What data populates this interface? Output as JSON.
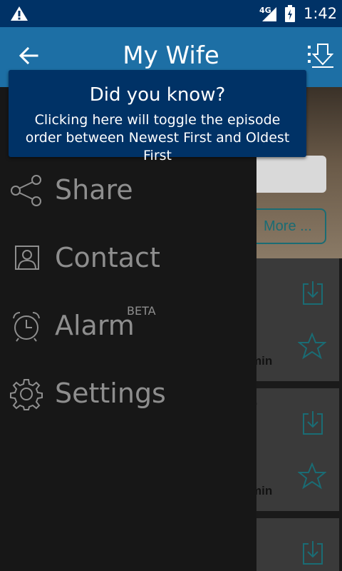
{
  "status_bar": {
    "network": "4G",
    "time": "1:42",
    "icons": [
      "warning-icon",
      "signal-icon",
      "battery-icon"
    ]
  },
  "app_bar": {
    "title": "My Wife",
    "icons": [
      "back-arrow-icon",
      "sort-order-icon"
    ]
  },
  "tooltip": {
    "title": "Did you know?",
    "body": "Clicking here will toggle the episode order between Newest First and Oldest First"
  },
  "drawer": {
    "items": [
      {
        "label": "Share",
        "icon": "share-icon"
      },
      {
        "label": "Contact",
        "icon": "contact-icon"
      },
      {
        "label": "Alarm",
        "icon": "alarm-clock-icon",
        "badge": "BETA"
      },
      {
        "label": "Settings",
        "icon": "gear-icon"
      }
    ]
  },
  "background": {
    "more_button": "More ...",
    "episodes": [
      {
        "duration_fragment": "min",
        "title_fragment": ""
      },
      {
        "duration_fragment": "min",
        "title_fragment": ".."
      }
    ]
  },
  "colors": {
    "status_bar": "#003266",
    "app_bar": "#1d6fa5",
    "drawer": "#171717",
    "drawer_text": "#8e8e8e",
    "accent_teal": "#1a6c74"
  }
}
